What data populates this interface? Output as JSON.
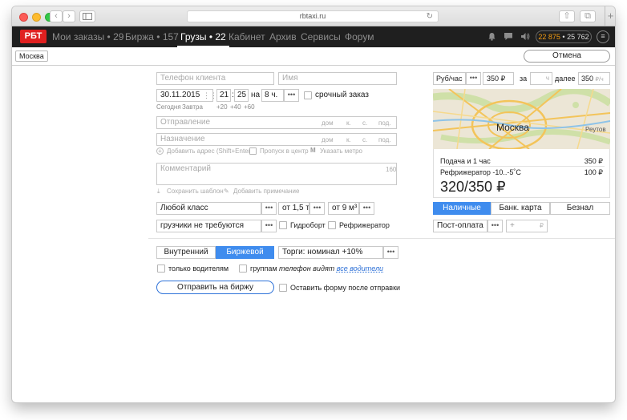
{
  "browser": {
    "url": "rbtaxi.ru"
  },
  "nav": {
    "logo": "РБТ",
    "items": [
      {
        "label": "Мои заказы • 29"
      },
      {
        "label": "Биржа • 157"
      },
      {
        "label": "Грузы • 22"
      },
      {
        "label": "Кабинет"
      },
      {
        "label": "Архив"
      },
      {
        "label": "Сервисы"
      },
      {
        "label": "Форум"
      }
    ],
    "balance_a": "22 875",
    "balance_sep": " • ",
    "balance_b": "25 762"
  },
  "subbar": {
    "city": "Москва",
    "cancel": "Отмена"
  },
  "form": {
    "phone_placeholder": "Телефон клиента",
    "name_placeholder": "Имя",
    "date": "30.11.2015",
    "hour": "21",
    "minute": "25",
    "on_label": "на",
    "duration": "8 ч.",
    "urgent_label": "срочный заказ",
    "today": "Сегодня",
    "tomorrow": "Завтра",
    "plus20": "+20",
    "plus40": "+40",
    "plus60": "+60",
    "departure_placeholder": "Отправление",
    "destination_placeholder": "Назначение",
    "addr_house": "дом",
    "addr_block": "к.",
    "addr_building": "с.",
    "addr_entrance": "под.",
    "add_address": "Добавить адрес (Shift+Enter)",
    "center_pass": "Пропуск в центр",
    "metro": "Указать метро",
    "comment_placeholder": "Комментарий",
    "comment_counter": "160",
    "save_template": "Сохранить шаблон",
    "add_note": "Добавить примечание",
    "car_class": "Любой класс",
    "weight": "от 1,5 т",
    "volume": "от 9 м³",
    "loaders": "грузчики не требуются",
    "hydroboard": "Гидроборт",
    "refrigerator": "Рефрижератор",
    "mode_internal": "Внутренний",
    "mode_exchange": "Биржевой",
    "auction": "Торги: номинал +10%",
    "only_drivers": "только водителям",
    "groups": "группам",
    "phone_visible_prefix": "телефон видят",
    "phone_visible_link": "все водители",
    "send_button": "Отправить на биржу",
    "keep_form": "Оставить форму после отправки"
  },
  "tariff": {
    "unit": "Руб/час",
    "price": "350 ₽",
    "for_label": "за",
    "hours_unit": "ч",
    "then_label": "далее",
    "then_price": "350",
    "then_unit": "₽/ч"
  },
  "map": {
    "city": "Москва",
    "district": "Реутов"
  },
  "price": {
    "row1_label": "Подача и 1 час",
    "row1_value": "350 ₽",
    "row2_label": "Рефрижератор -10..-5˚С",
    "row2_value": "100 ₽",
    "total": "320/350 ₽"
  },
  "payment": {
    "cash": "Наличные",
    "card": "Банк. карта",
    "cashless": "Безнал",
    "postpay": "Пост-оплата",
    "plus": "+",
    "currency": "₽"
  }
}
